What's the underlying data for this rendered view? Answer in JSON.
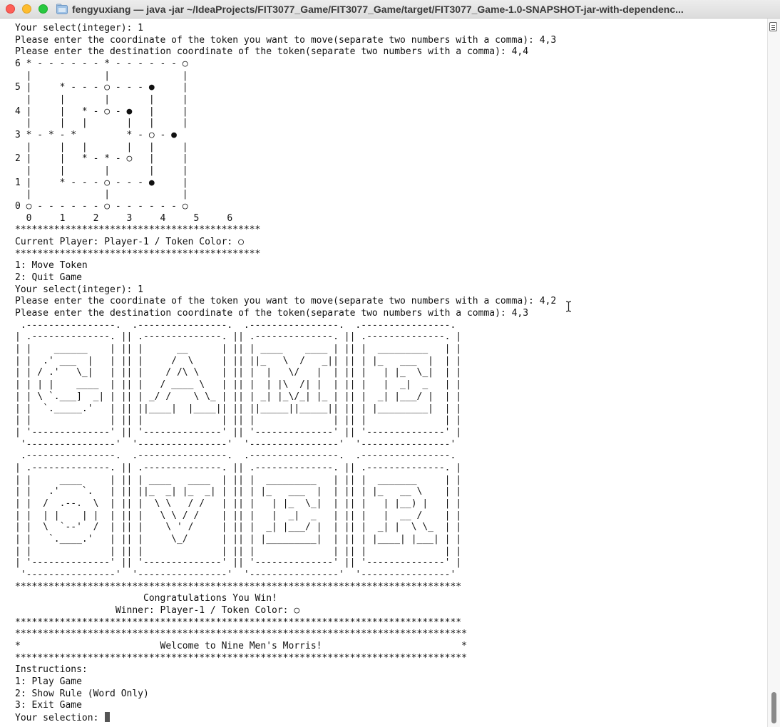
{
  "window": {
    "title": "fengyuxiang — java -jar ~/IdeaProjects/FIT3077_Game/FIT3077_Game/target/FIT3077_Game-1.0-SNAPSHOT-jar-with-dependenc..."
  },
  "terminal": {
    "lines": [
      "Your select(integer): 1",
      "Please enter the coordinate of the token you want to move(separate two numbers with a comma): 4,3",
      "Please enter the destination coordinate of the token(separate two numbers with a comma): 4,4",
      "6 * - - - - - - * - - - - - - ○",
      "  |             |             |",
      "5 |     * - - - ○ - - - ●     |",
      "  |     |       |       |     |",
      "4 |     |   * - ○ - ●   |     |",
      "  |     |   |       |   |     |",
      "3 * - * - *         * - ○ - ●",
      "  |     |   |       |   |     |",
      "2 |     |   * - * - ○   |     |",
      "  |     |       |       |     |",
      "1 |     * - - - ○ - - - ●     |",
      "  |             |             |",
      "0 ○ - - - - - - ○ - - - - - - ○",
      "  0     1     2     3     4     5     6",
      "********************************************",
      "Current Player: Player-1 / Token Color: ○",
      "********************************************",
      "1: Move Token",
      "2: Quit Game",
      "Your select(integer): 1",
      "Please enter the coordinate of the token you want to move(separate two numbers with a comma): 4,2",
      "Please enter the destination coordinate of the token(separate two numbers with a comma): 4,3",
      " .----------------.  .----------------.  .----------------.  .----------------.",
      "| .--------------. || .--------------. || .--------------. || .--------------. |",
      "| |    ______    | || |      __      | || | ____    ____ | || |  _________   | |",
      "| |  .' ___  |   | || |     /  \\     | || ||_   \\  /   _|| || | |_   ___  |  | |",
      "| | / .'   \\_|   | || |    / /\\ \\    | || |  |   \\/   |  | || |   | |_  \\_|  | |",
      "| | | |    ____  | || |   / ____ \\   | || |  | |\\  /| |  | || |   |  _|  _   | |",
      "| | \\ `.___]  _| | || | _/ /    \\ \\_ | || | _| |_\\/_| |_ | || |  _| |___/ |  | |",
      "| |  `._____.'   | || ||____|  |____|| || ||_____||_____|| || | |_________|  | |",
      "| |              | || |              | || |              | || |              | |",
      "| '--------------' || '--------------' || '--------------' || '--------------' |",
      " '----------------'  '----------------'  '----------------'  '----------------'",
      " .----------------.  .----------------.  .----------------.  .----------------.",
      "| .--------------. || .--------------. || .--------------. || .--------------. |",
      "| |     ____     | || | ____   ____  | || |  _________   | || |  _______     | |",
      "| |   .'    `.   | || ||_  _| |_  _| | || | |_   ___  |  | || | |_   __ \\    | |",
      "| |  /  .--.  \\  | || |  \\ \\   / /   | || |   | |_  \\_|  | || |   | |__) |   | |",
      "| |  | |    | |  | || |   \\ \\ / /    | || |   |  _|  _   | || |   |  __ /    | |",
      "| |  \\  `--'  /  | || |    \\ ' /     | || |  _| |___/ |  | || |  _| |  \\ \\_  | |",
      "| |   `.____.'   | || |     \\_/      | || | |_________|  | || | |____| |___| | |",
      "| |              | || |              | || |              | || |              | |",
      "| '--------------' || '--------------' || '--------------' || '--------------' |",
      " '----------------'  '----------------'  '----------------'  '----------------'",
      "********************************************************************************",
      "                       Congratulations You Win!",
      "                  Winner: Player-1 / Token Color: ○",
      "********************************************************************************",
      "*********************************************************************************",
      "*                         Welcome to Nine Men's Morris!                         *",
      "*********************************************************************************",
      "Instructions:",
      "1: Play Game",
      "2: Show Rule (Word Only)",
      "3: Exit Game"
    ],
    "prompt": "Your selection: "
  },
  "colors": {
    "background": "#ffffff",
    "text": "#111111",
    "titlebar": "#e6e6e6"
  },
  "icons": [
    "close-light",
    "minimize-light",
    "maximize-light",
    "folder-icon",
    "ibeam-cursor-icon",
    "scroll-marker-icon"
  ]
}
